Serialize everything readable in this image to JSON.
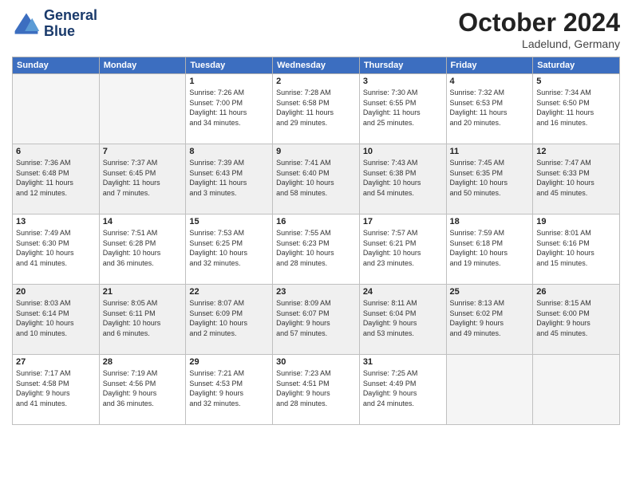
{
  "header": {
    "logo_line1": "General",
    "logo_line2": "Blue",
    "month": "October 2024",
    "location": "Ladelund, Germany"
  },
  "weekdays": [
    "Sunday",
    "Monday",
    "Tuesday",
    "Wednesday",
    "Thursday",
    "Friday",
    "Saturday"
  ],
  "rows": [
    [
      {
        "day": "",
        "info": ""
      },
      {
        "day": "",
        "info": ""
      },
      {
        "day": "1",
        "info": "Sunrise: 7:26 AM\nSunset: 7:00 PM\nDaylight: 11 hours\nand 34 minutes."
      },
      {
        "day": "2",
        "info": "Sunrise: 7:28 AM\nSunset: 6:58 PM\nDaylight: 11 hours\nand 29 minutes."
      },
      {
        "day": "3",
        "info": "Sunrise: 7:30 AM\nSunset: 6:55 PM\nDaylight: 11 hours\nand 25 minutes."
      },
      {
        "day": "4",
        "info": "Sunrise: 7:32 AM\nSunset: 6:53 PM\nDaylight: 11 hours\nand 20 minutes."
      },
      {
        "day": "5",
        "info": "Sunrise: 7:34 AM\nSunset: 6:50 PM\nDaylight: 11 hours\nand 16 minutes."
      }
    ],
    [
      {
        "day": "6",
        "info": "Sunrise: 7:36 AM\nSunset: 6:48 PM\nDaylight: 11 hours\nand 12 minutes."
      },
      {
        "day": "7",
        "info": "Sunrise: 7:37 AM\nSunset: 6:45 PM\nDaylight: 11 hours\nand 7 minutes."
      },
      {
        "day": "8",
        "info": "Sunrise: 7:39 AM\nSunset: 6:43 PM\nDaylight: 11 hours\nand 3 minutes."
      },
      {
        "day": "9",
        "info": "Sunrise: 7:41 AM\nSunset: 6:40 PM\nDaylight: 10 hours\nand 58 minutes."
      },
      {
        "day": "10",
        "info": "Sunrise: 7:43 AM\nSunset: 6:38 PM\nDaylight: 10 hours\nand 54 minutes."
      },
      {
        "day": "11",
        "info": "Sunrise: 7:45 AM\nSunset: 6:35 PM\nDaylight: 10 hours\nand 50 minutes."
      },
      {
        "day": "12",
        "info": "Sunrise: 7:47 AM\nSunset: 6:33 PM\nDaylight: 10 hours\nand 45 minutes."
      }
    ],
    [
      {
        "day": "13",
        "info": "Sunrise: 7:49 AM\nSunset: 6:30 PM\nDaylight: 10 hours\nand 41 minutes."
      },
      {
        "day": "14",
        "info": "Sunrise: 7:51 AM\nSunset: 6:28 PM\nDaylight: 10 hours\nand 36 minutes."
      },
      {
        "day": "15",
        "info": "Sunrise: 7:53 AM\nSunset: 6:25 PM\nDaylight: 10 hours\nand 32 minutes."
      },
      {
        "day": "16",
        "info": "Sunrise: 7:55 AM\nSunset: 6:23 PM\nDaylight: 10 hours\nand 28 minutes."
      },
      {
        "day": "17",
        "info": "Sunrise: 7:57 AM\nSunset: 6:21 PM\nDaylight: 10 hours\nand 23 minutes."
      },
      {
        "day": "18",
        "info": "Sunrise: 7:59 AM\nSunset: 6:18 PM\nDaylight: 10 hours\nand 19 minutes."
      },
      {
        "day": "19",
        "info": "Sunrise: 8:01 AM\nSunset: 6:16 PM\nDaylight: 10 hours\nand 15 minutes."
      }
    ],
    [
      {
        "day": "20",
        "info": "Sunrise: 8:03 AM\nSunset: 6:14 PM\nDaylight: 10 hours\nand 10 minutes."
      },
      {
        "day": "21",
        "info": "Sunrise: 8:05 AM\nSunset: 6:11 PM\nDaylight: 10 hours\nand 6 minutes."
      },
      {
        "day": "22",
        "info": "Sunrise: 8:07 AM\nSunset: 6:09 PM\nDaylight: 10 hours\nand 2 minutes."
      },
      {
        "day": "23",
        "info": "Sunrise: 8:09 AM\nSunset: 6:07 PM\nDaylight: 9 hours\nand 57 minutes."
      },
      {
        "day": "24",
        "info": "Sunrise: 8:11 AM\nSunset: 6:04 PM\nDaylight: 9 hours\nand 53 minutes."
      },
      {
        "day": "25",
        "info": "Sunrise: 8:13 AM\nSunset: 6:02 PM\nDaylight: 9 hours\nand 49 minutes."
      },
      {
        "day": "26",
        "info": "Sunrise: 8:15 AM\nSunset: 6:00 PM\nDaylight: 9 hours\nand 45 minutes."
      }
    ],
    [
      {
        "day": "27",
        "info": "Sunrise: 7:17 AM\nSunset: 4:58 PM\nDaylight: 9 hours\nand 41 minutes."
      },
      {
        "day": "28",
        "info": "Sunrise: 7:19 AM\nSunset: 4:56 PM\nDaylight: 9 hours\nand 36 minutes."
      },
      {
        "day": "29",
        "info": "Sunrise: 7:21 AM\nSunset: 4:53 PM\nDaylight: 9 hours\nand 32 minutes."
      },
      {
        "day": "30",
        "info": "Sunrise: 7:23 AM\nSunset: 4:51 PM\nDaylight: 9 hours\nand 28 minutes."
      },
      {
        "day": "31",
        "info": "Sunrise: 7:25 AM\nSunset: 4:49 PM\nDaylight: 9 hours\nand 24 minutes."
      },
      {
        "day": "",
        "info": ""
      },
      {
        "day": "",
        "info": ""
      }
    ]
  ]
}
